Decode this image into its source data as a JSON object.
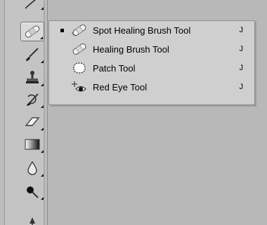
{
  "toolbar": {
    "tools": [
      {
        "icon": "pen-tip-icon"
      },
      {
        "icon": "healing-brush-icon"
      },
      {
        "icon": "brush-icon"
      },
      {
        "icon": "clone-stamp-icon"
      },
      {
        "icon": "history-brush-icon"
      },
      {
        "icon": "eraser-icon"
      },
      {
        "icon": "gradient-icon"
      },
      {
        "icon": "blur-icon"
      },
      {
        "icon": "dodge-icon"
      },
      {
        "icon": "pen-icon"
      }
    ]
  },
  "flyout": {
    "items": [
      {
        "label": "Spot Healing Brush Tool",
        "shortcut": "J",
        "icon": "spot-healing-brush-icon",
        "selected": true
      },
      {
        "label": "Healing Brush Tool",
        "shortcut": "J",
        "icon": "healing-brush-icon",
        "selected": false
      },
      {
        "label": "Patch Tool",
        "shortcut": "J",
        "icon": "patch-icon",
        "selected": false
      },
      {
        "label": "Red Eye Tool",
        "shortcut": "J",
        "icon": "red-eye-icon",
        "selected": false
      }
    ]
  }
}
